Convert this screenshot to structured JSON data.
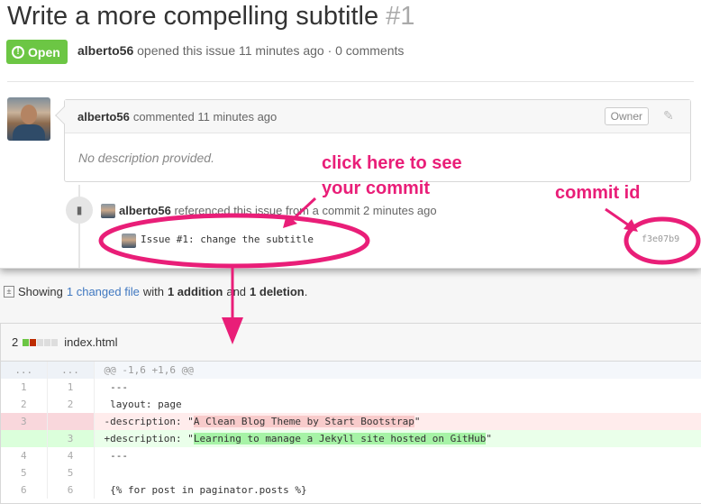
{
  "issue": {
    "title": "Write a more compelling subtitle",
    "number": "#1",
    "state": "Open",
    "author": "alberto56",
    "meta_text": "opened this issue 11 minutes ago · 0 comments"
  },
  "comment": {
    "author": "alberto56",
    "meta_text": "commented 11 minutes ago",
    "owner_label": "Owner",
    "body": "No description provided."
  },
  "reference": {
    "author": "alberto56",
    "text": "referenced this issue from a commit 2 minutes ago",
    "commit_message": "Issue #1: change the subtitle",
    "sha": "f3e07b9"
  },
  "summary": {
    "prefix": "Showing",
    "changed_link": "1 changed file",
    "with": "with",
    "additions": "1 addition",
    "and": "and",
    "deletions": "1 deletion",
    "suffix": "."
  },
  "file": {
    "change_count": "2",
    "name": "index.html",
    "diffstat_colors": [
      "#6cc644",
      "#bd2c00",
      "#ddd",
      "#ddd",
      "#ddd"
    ],
    "lines": [
      {
        "type": "hunk",
        "old": "...",
        "new": "...",
        "code": "@@ -1,6 +1,6 @@"
      },
      {
        "type": "ctx",
        "old": "1",
        "new": "1",
        "code": " ---"
      },
      {
        "type": "ctx",
        "old": "2",
        "new": "2",
        "code": " layout: page"
      },
      {
        "type": "del",
        "old": "3",
        "new": "",
        "code_pre": "-description: \"",
        "code_hl": "A Clean Blog Theme by Start Bootstrap",
        "code_post": "\""
      },
      {
        "type": "add",
        "old": "",
        "new": "3",
        "code_pre": "+description: \"",
        "code_hl": "Learning to manage a Jekyll site hosted on GitHub",
        "code_post": "\""
      },
      {
        "type": "ctx",
        "old": "4",
        "new": "4",
        "code": " ---"
      },
      {
        "type": "ctx",
        "old": "5",
        "new": "5",
        "code": ""
      },
      {
        "type": "ctx",
        "old": "6",
        "new": "6",
        "code": " {% for post in paginator.posts %}"
      }
    ]
  },
  "annotations": {
    "click_here_line1": "click here to see",
    "click_here_line2": "your commit",
    "commit_id": "commit id",
    "color": "#e91e78"
  }
}
